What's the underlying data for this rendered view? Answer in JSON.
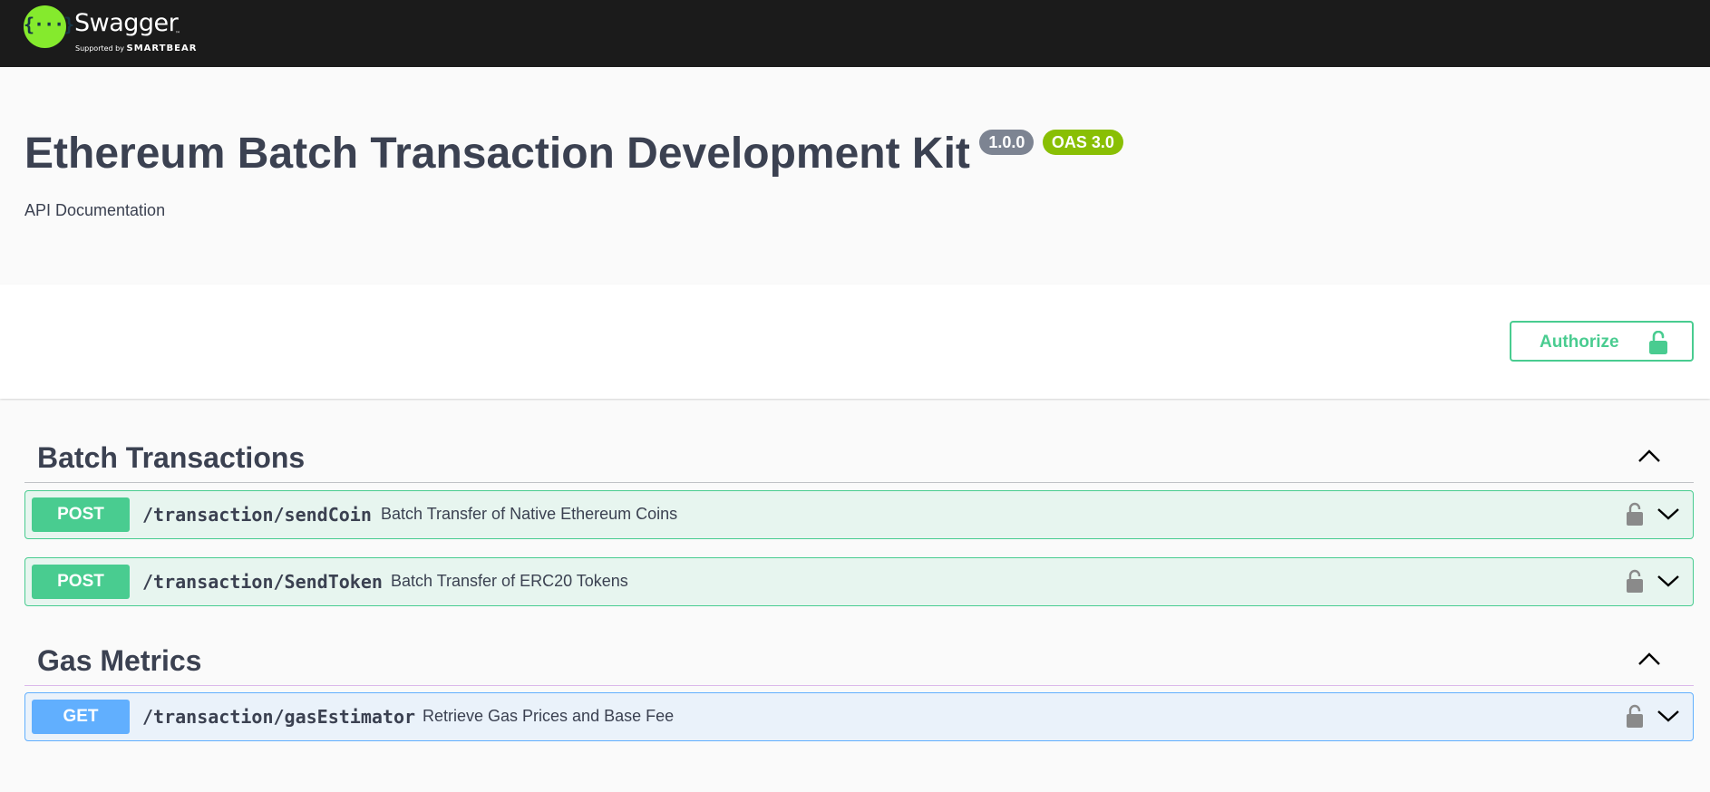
{
  "topbar": {
    "logo_glyph": "{···}",
    "logo_name": "Swagger",
    "logo_tm": "™",
    "support_prefix": "Supported by",
    "support_brand": "SMARTBEAR",
    "brand_color": "#85ea2d",
    "background": "#1b1b1b"
  },
  "info": {
    "title": "Ethereum Batch Transaction Development Kit",
    "version": "1.0.0",
    "oas": "OAS 3.0",
    "description": "API Documentation"
  },
  "auth": {
    "authorize_label": "Authorize",
    "icon": "unlocked-lock-icon"
  },
  "tags": [
    {
      "name": "Batch Transactions",
      "expanded": true,
      "operations": [
        {
          "method": "POST",
          "path": "/transaction/sendCoin",
          "summary": "Batch Transfer of Native Ethereum Coins"
        },
        {
          "method": "POST",
          "path": "/transaction/SendToken",
          "summary": "Batch Transfer of ERC20 Tokens"
        }
      ]
    },
    {
      "name": "Gas Metrics",
      "expanded": true,
      "operations": [
        {
          "method": "GET",
          "path": "/transaction/gasEstimator",
          "summary": "Retrieve Gas Prices and Base Fee"
        }
      ]
    }
  ],
  "colors": {
    "post": "#49cc90",
    "get": "#61affe",
    "text": "#3b4151",
    "version_badge": "#7d8492",
    "oas_badge": "#89bf04"
  }
}
